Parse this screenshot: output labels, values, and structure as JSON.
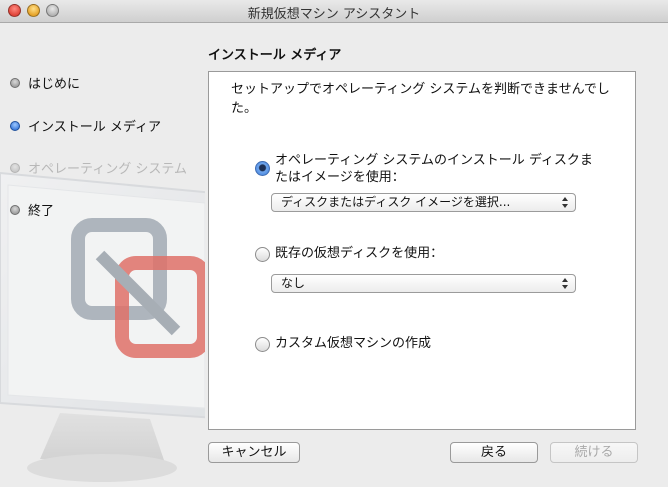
{
  "window": {
    "title": "新規仮想マシン アシスタント"
  },
  "sidebar": {
    "steps": [
      {
        "label": "はじめに",
        "state": "done"
      },
      {
        "label": "インストール メディア",
        "state": "current"
      },
      {
        "label": "オペレーティング システム",
        "state": "pending"
      },
      {
        "label": "終了",
        "state": "pending"
      }
    ]
  },
  "panel": {
    "title": "インストール メディア",
    "message": "セットアップでオペレーティング システムを判断できませんでした。",
    "options": [
      {
        "label": "オペレーティング システムのインストール ディスクまたはイメージを使用：",
        "selected": true,
        "select_value": "ディスクまたはディスク イメージを選択..."
      },
      {
        "label": "既存の仮想ディスクを使用：",
        "selected": false,
        "select_value": "なし"
      },
      {
        "label": "カスタム仮想マシンの作成",
        "selected": false
      }
    ]
  },
  "buttons": {
    "cancel": "キャンセル",
    "back": "戻る",
    "continue": "続ける",
    "continue_enabled": false
  },
  "colors": {
    "active_step": "#1f64d0",
    "panel_bg": "#ffffff",
    "window_bg": "#ececec",
    "logo_red": "#d9453b",
    "logo_gray": "#9ba3ad"
  },
  "icons": [
    "close-window-icon",
    "minimize-window-icon",
    "zoom-window-icon",
    "vmware-fusion-monitor-icon",
    "popup-arrows-icon"
  ]
}
